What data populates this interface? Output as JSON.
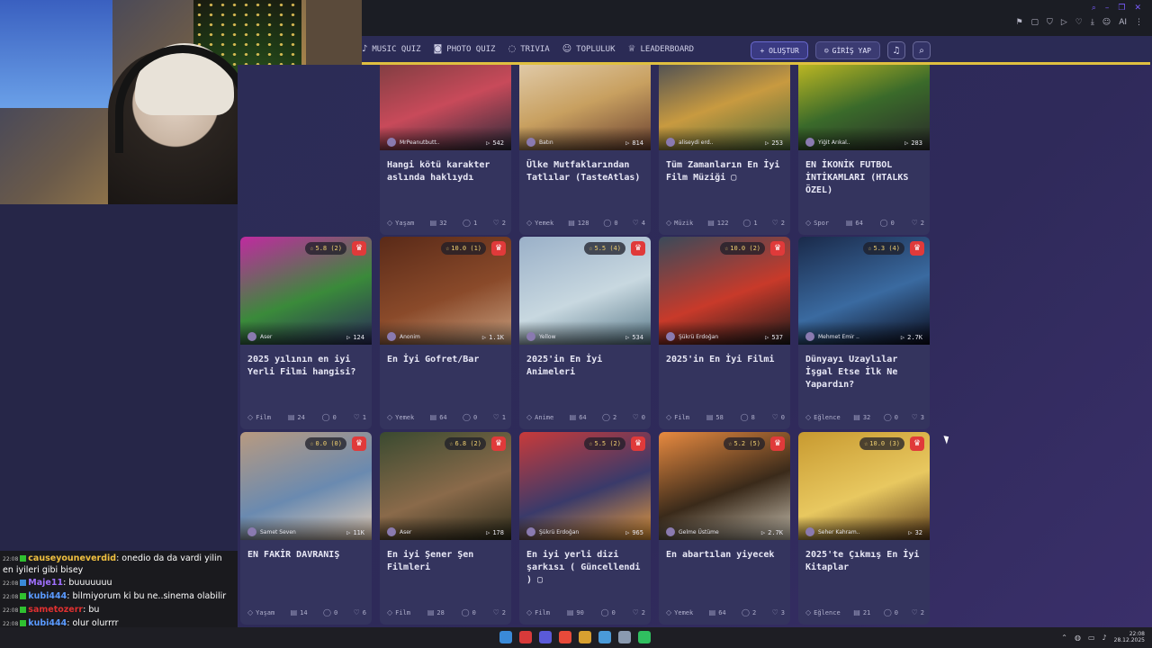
{
  "browser": {
    "icons": [
      "bookmark-icon",
      "square-icon",
      "shield-icon",
      "play-icon",
      "heart-icon",
      "download-icon",
      "person-icon",
      "settings-icon"
    ],
    "ai_label": "AI"
  },
  "nav": {
    "items": [
      {
        "label": "MUSIC QUIZ",
        "icon": "♪"
      },
      {
        "label": "PHOTO QUIZ",
        "icon": "◙"
      },
      {
        "label": "TRIVIA",
        "icon": "◌"
      },
      {
        "label": "TOPLULUK",
        "icon": "☺"
      },
      {
        "label": "LEADERBOARD",
        "icon": "♕"
      }
    ],
    "create_label": "+ OLUŞTUR",
    "login_label": "GİRİŞ YAP",
    "login_icon": "☺",
    "bell_icon": "🔔",
    "search_icon": "⌕"
  },
  "chat": {
    "messages": [
      {
        "time": "22:08",
        "user": "causeyouneverdid",
        "color": "#f0c040",
        "text": ": onedio da da vardi yilin en iyileri gibi bisey"
      },
      {
        "time": "22:08",
        "user": "Maje11",
        "color": "#a070ff",
        "text": ": buuuuuuu"
      },
      {
        "time": "22:08",
        "user": "kubi444",
        "color": "#5a9aff",
        "text": ": bilmiyorum ki bu ne..sinema olabilir"
      },
      {
        "time": "22:08",
        "user": "sametozerr",
        "color": "#e03030",
        "text": ": bu"
      },
      {
        "time": "22:08",
        "user": "kubi444",
        "color": "#5a9aff",
        "text": ": olur olurrrr"
      }
    ]
  },
  "cards": [
    {
      "title": "Hangi kötü karakter aslında haklıydı",
      "author": "MrPeanutbutt..",
      "plays": "542",
      "category": "Yaşam",
      "questions": "32",
      "comments": "1",
      "likes": "2",
      "rating": "",
      "colors": [
        "#6a3a3a",
        "#c84a5a",
        "#2a2a3a"
      ]
    },
    {
      "title": "Ülke Mutfaklarından Tatlılar (TasteAtlas)",
      "author": "Batın",
      "plays": "814",
      "category": "Yemek",
      "questions": "128",
      "comments": "0",
      "likes": "4",
      "rating": "",
      "colors": [
        "#e8d8c0",
        "#c8a060",
        "#6a4030"
      ]
    },
    {
      "title": "Tüm Zamanların En İyi Film Müziği ▢",
      "author": "aliseydi erd..",
      "plays": "253",
      "category": "Müzik",
      "questions": "122",
      "comments": "1",
      "likes": "2",
      "rating": "",
      "colors": [
        "#2a3a5a",
        "#c89a40",
        "#4a6a3a"
      ]
    },
    {
      "title": "EN İKONİK FUTBOL İNTİKAMLARI (HTALKS ÖZEL)",
      "author": "Yiğit Arıkal..",
      "plays": "283",
      "category": "Spor",
      "questions": "64",
      "comments": "0",
      "likes": "2",
      "rating": "",
      "colors": [
        "#e8d020",
        "#3a6a2a",
        "#2a2a2a"
      ]
    },
    {
      "title": "2025 yılının en iyi Yerli Filmi hangisi?",
      "author": "Aser",
      "plays": "124",
      "category": "Film",
      "questions": "24",
      "comments": "0",
      "likes": "1",
      "rating": "5.8 (2)",
      "colors": [
        "#c02aa0",
        "#3a8a3a",
        "#2a2a5a"
      ]
    },
    {
      "title": "En İyi Gofret/Bar",
      "author": "Anonim",
      "plays": "1.1K",
      "category": "Yemek",
      "questions": "64",
      "comments": "0",
      "likes": "1",
      "rating": "10.0 (1)",
      "colors": [
        "#5a2a18",
        "#8a4a2a",
        "#c8a080"
      ]
    },
    {
      "title": "2025'in En İyi Animeleri",
      "author": "Yellow",
      "plays": "534",
      "category": "Anime",
      "questions": "64",
      "comments": "2",
      "likes": "0",
      "rating": "5.5 (4)",
      "colors": [
        "#9ab0c8",
        "#c8d8e0",
        "#5a7a8a"
      ]
    },
    {
      "title": "2025'in En İyi Filmi",
      "author": "Şükrü Erdoğan",
      "plays": "537",
      "category": "Film",
      "questions": "58",
      "comments": "8",
      "likes": "0",
      "rating": "10.0 (2)",
      "colors": [
        "#3a4a5a",
        "#c83a2a",
        "#1a1a1a"
      ]
    },
    {
      "title": "Dünyayı Uzaylılar İşgal Etse İlk Ne Yapardın?",
      "author": "Mehmet Emir ..",
      "plays": "2.7K",
      "category": "Eğlence",
      "questions": "32",
      "comments": "0",
      "likes": "3",
      "rating": "5.3 (4)",
      "colors": [
        "#1a2a4a",
        "#3a6aa0",
        "#0a0a1a"
      ]
    },
    {
      "title": "EN FAKİR DAVRANIŞ",
      "author": "Samet Seven",
      "plays": "11K",
      "category": "Yaşam",
      "questions": "14",
      "comments": "0",
      "likes": "6",
      "rating": "0.0 (0)",
      "colors": [
        "#b89a80",
        "#6a8ab0",
        "#e8d0b8"
      ]
    },
    {
      "title": "En iyi Şener Şen Filmleri",
      "author": "Aser",
      "plays": "178",
      "category": "Film",
      "questions": "28",
      "comments": "0",
      "likes": "2",
      "rating": "6.8 (2)",
      "colors": [
        "#3a4a30",
        "#8a6a4a",
        "#2a2a1a"
      ]
    },
    {
      "title": "En iyi yerli dizi şarkısı ( Güncellendi ) ▢",
      "author": "Şükrü Erdoğan",
      "plays": "965",
      "category": "Film",
      "questions": "90",
      "comments": "0",
      "likes": "2",
      "rating": "5.5 (2)",
      "colors": [
        "#c83a3a",
        "#3a3a6a",
        "#e89a3a"
      ]
    },
    {
      "title": "En abartılan yiyecek",
      "author": "Gelme Üstüme",
      "plays": "2.7K",
      "category": "Yemek",
      "questions": "64",
      "comments": "2",
      "likes": "3",
      "rating": "5.2 (5)",
      "colors": [
        "#e88a40",
        "#3a2a1a",
        "#c8c0b0"
      ]
    },
    {
      "title": "2025'te Çıkmış En İyi Kitaplar",
      "author": "Seher Kahram..",
      "plays": "32",
      "category": "Eğlence",
      "questions": "21",
      "comments": "0",
      "likes": "2",
      "rating": "10.0 (3)",
      "colors": [
        "#c89a30",
        "#e8c860",
        "#5a3a1a"
      ]
    }
  ],
  "taskbar": {
    "apps": [
      "#3a8ad8",
      "#d83a3a",
      "#5a5ad8",
      "#e84a3a",
      "#d8a030",
      "#4a9ad8",
      "#8a9ab0",
      "#30c060"
    ],
    "time": "22:08",
    "date": "28.12.2025"
  }
}
